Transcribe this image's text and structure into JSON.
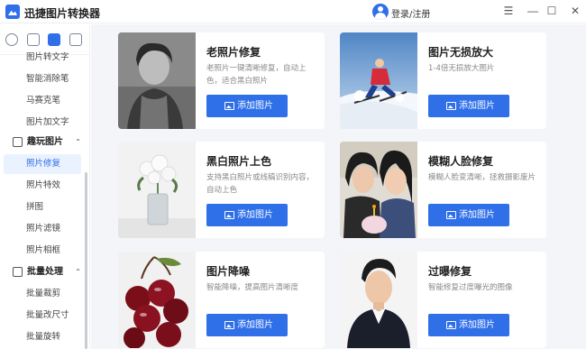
{
  "app": {
    "title": "迅捷图片转换器"
  },
  "header": {
    "login_label": "登录/注册"
  },
  "window": {
    "menu": "☰",
    "minimize": "—",
    "maximize": "☐",
    "close": "✕"
  },
  "sidebar": {
    "items": [
      {
        "label": "图片转文字"
      },
      {
        "label": "智能消除笔"
      },
      {
        "label": "马赛克笔"
      },
      {
        "label": "图片加文字"
      }
    ],
    "groups": [
      {
        "label": "趣玩图片",
        "items": [
          {
            "label": "照片修复",
            "active": true
          },
          {
            "label": "照片特效"
          },
          {
            "label": "拼图"
          },
          {
            "label": "照片滤镜"
          },
          {
            "label": "照片相框"
          }
        ]
      },
      {
        "label": "批量处理",
        "items": [
          {
            "label": "批量裁剪"
          },
          {
            "label": "批量改尺寸"
          },
          {
            "label": "批量旋转"
          }
        ]
      }
    ]
  },
  "cards": [
    {
      "title": "老照片修复",
      "desc": "老照片一键清晰修复，自动上色，适合黑白照片",
      "button": "添加图片"
    },
    {
      "title": "图片无损放大",
      "desc": "1-4倍无损放大图片",
      "button": "添加图片"
    },
    {
      "title": "黑白照片上色",
      "desc": "支持黑白照片或线稿识别内容，自动上色",
      "button": "添加图片"
    },
    {
      "title": "模糊人脸修复",
      "desc": "模糊人脸变清晰，拯救摄影废片",
      "button": "添加图片"
    },
    {
      "title": "图片降噪",
      "desc": "智能降噪，提高图片清晰度",
      "button": "添加图片"
    },
    {
      "title": "过曝修复",
      "desc": "智能修复过度曝光的图像",
      "button": "添加图片"
    }
  ],
  "colors": {
    "accent": "#2f6fe8",
    "background": "#f3f5f9",
    "active_bg": "#eaf1ff"
  }
}
